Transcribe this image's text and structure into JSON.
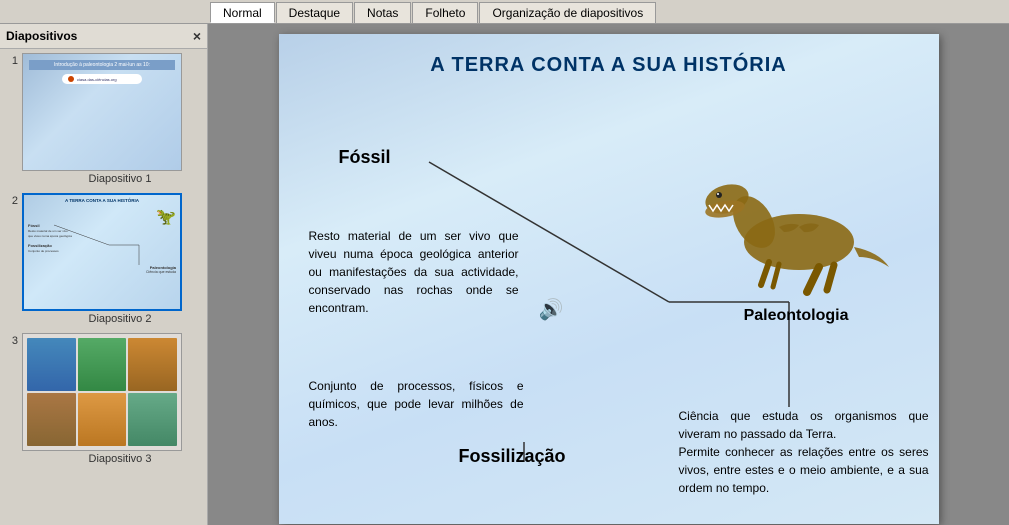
{
  "tabs": [
    {
      "id": "normal",
      "label": "Normal",
      "active": true
    },
    {
      "id": "destaque",
      "label": "Destaque",
      "active": false
    },
    {
      "id": "notas",
      "label": "Notas",
      "active": false
    },
    {
      "id": "folheto",
      "label": "Folheto",
      "active": false
    },
    {
      "id": "organizacao",
      "label": "Organização de diapositivos",
      "active": false
    }
  ],
  "sidebar": {
    "header": "Diapositivos",
    "close_label": "×",
    "slides": [
      {
        "number": "1",
        "label": "Diapositivo 1"
      },
      {
        "number": "2",
        "label": "Diapositivo 2"
      },
      {
        "number": "3",
        "label": "Diapositivo 3"
      }
    ]
  },
  "slide": {
    "title": "A TERRA CONTA A SUA HISTÓRIA",
    "fossil_label": "Fóssil",
    "fossil_text": "Resto material de um ser vivo que viveu numa época geológica anterior ou manifestações da sua actividade, conservado nas rochas onde se encontram.",
    "fossilizacao_label": "Fossilização",
    "fossilizacao_text": "Conjunto de processos, físicos e químicos, que pode levar milhões de anos.",
    "paleontologia_label": "Paleontologia",
    "paleontologia_text": "Ciência que estuda os organismos que viveram no passado da Terra.\nPermite conhecer as relações entre os seres vivos, entre estes e o meio ambiente, e a sua ordem no tempo."
  },
  "colors": {
    "accent_blue": "#003366",
    "tab_active_bg": "#ffffff",
    "tab_inactive_bg": "#e8e4dc"
  }
}
